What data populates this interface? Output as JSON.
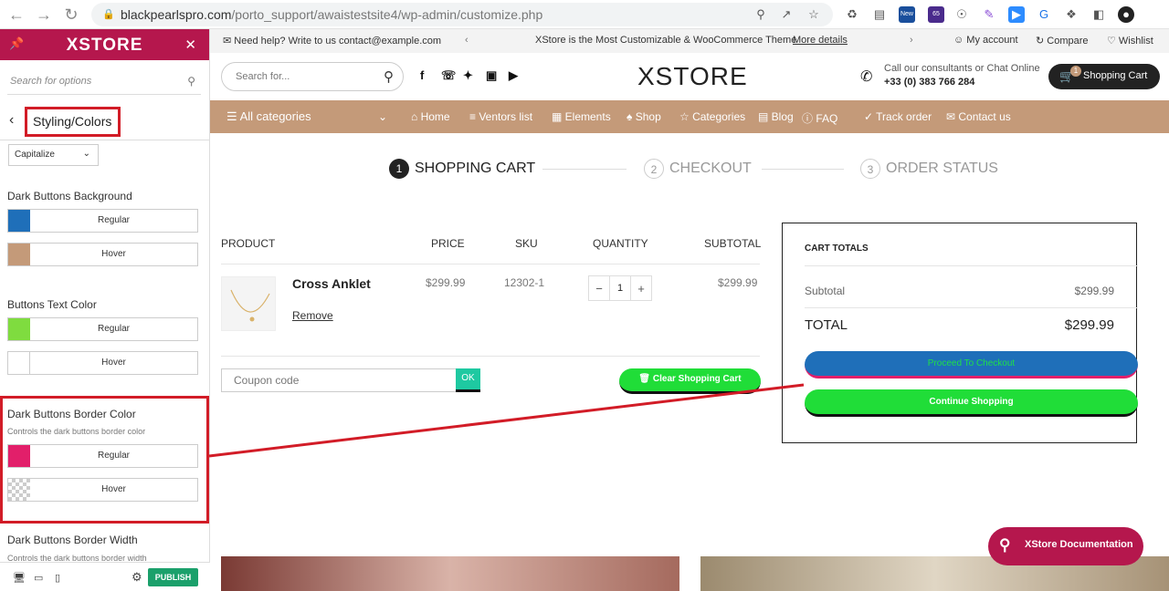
{
  "browser": {
    "url_host": "blackpearlspro.com",
    "url_path": "/porto_support/awaistestsite4/wp-admin/customize.php",
    "ext_badge_new": "New",
    "ext_badge_count": "65"
  },
  "sidebar": {
    "logo": "XSTORE",
    "search_placeholder": "Search for options",
    "breadcrumb": "Styling/Colors",
    "select_value": "Capitalize",
    "sections": {
      "dark_bg_label": "Dark Buttons Background",
      "dark_bg_regular": "Regular",
      "dark_bg_hover": "Hover",
      "text_color_label": "Buttons Text Color",
      "text_color_regular": "Regular",
      "text_color_hover": "Hover",
      "border_color_label": "Dark Buttons Border Color",
      "border_color_desc": "Controls the dark buttons border color",
      "border_color_regular": "Regular",
      "border_color_hover": "Hover",
      "border_width_label": "Dark Buttons Border Width",
      "border_width_desc": "Controls the dark buttons border width"
    },
    "publish": "PUBLISH"
  },
  "colors": {
    "dark_bg_regular": "#1f6fb9",
    "dark_bg_hover": "#c49a79",
    "text_regular": "#7fdc3f",
    "text_hover": "#ffffff",
    "border_regular": "#e21f6a",
    "accent": "#b5174d",
    "menu_bg": "#c49a79"
  },
  "topbar": {
    "help": "Need help? Write to us contact@example.com",
    "promo": "XStore is the Most Customizable & WooCommerce Theme",
    "promo_link": "More details",
    "account": "My account",
    "compare": "Compare",
    "wishlist": "Wishlist"
  },
  "header": {
    "search_placeholder": "Search for...",
    "brand": "XSTORE",
    "call_line1": "Call our consultants or Chat Online",
    "call_line2": "+33 (0) 383 766 284",
    "cart_label": "Shopping Cart",
    "cart_count": "1"
  },
  "menu": [
    "All categories",
    "Home",
    "Ventors list",
    "Elements",
    "Shop",
    "Categories",
    "Blog",
    "FAQ",
    "Track order",
    "Contact us"
  ],
  "steps": [
    {
      "num": "1",
      "label": "SHOPPING CART"
    },
    {
      "num": "2",
      "label": "CHECKOUT"
    },
    {
      "num": "3",
      "label": "ORDER STATUS"
    }
  ],
  "cart": {
    "headers": [
      "PRODUCT",
      "PRICE",
      "SKU",
      "QUANTITY",
      "SUBTOTAL"
    ],
    "item": {
      "name": "Cross Anklet",
      "price": "$299.99",
      "sku": "12302-1",
      "qty": "1",
      "subtotal": "$299.99",
      "remove": "Remove"
    },
    "coupon_placeholder": "Coupon code",
    "ok": "OK",
    "clear": "Clear Shopping Cart"
  },
  "totals": {
    "title": "CART TOTALS",
    "subtotal_label": "Subtotal",
    "subtotal_value": "$299.99",
    "total_label": "TOTAL",
    "total_value": "$299.99",
    "proceed": "Proceed To Checkout",
    "continue": "Continue Shopping"
  },
  "doc_button": "XStore Documentation"
}
